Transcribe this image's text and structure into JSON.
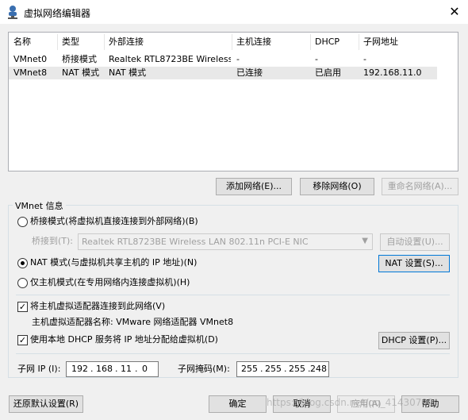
{
  "window": {
    "title": "虚拟网络编辑器",
    "close_glyph": "✕",
    "icon_name": "network-user-icon"
  },
  "table": {
    "columns": [
      "名称",
      "类型",
      "外部连接",
      "主机连接",
      "DHCP",
      "子网地址"
    ],
    "rows": [
      [
        "VMnet0",
        "桥接模式",
        "Realtek RTL8723BE Wireless...",
        "-",
        "-",
        "-"
      ],
      [
        "VMnet8",
        "NAT 模式",
        "NAT 模式",
        "已连接",
        "已启用",
        "192.168.11.0"
      ]
    ],
    "selected_row": 1
  },
  "list_buttons": {
    "add": "添加网络(E)...",
    "remove": "移除网络(O)",
    "rename": "重命名网络(A)..."
  },
  "vmnet_info": {
    "group_label": "VMnet 信息",
    "bridged_radio": "桥接模式(将虚拟机直接连接到外部网络)(B)",
    "bridged_to_label": "桥接到(T):",
    "bridged_to_value": "Realtek RTL8723BE Wireless LAN 802.11n PCI-E NIC",
    "auto_settings": "自动设置(U)...",
    "nat_radio": "NAT 模式(与虚拟机共享主机的 IP 地址)(N)",
    "nat_settings": "NAT 设置(S)...",
    "hostonly_radio": "仅主机模式(在专用网络内连接虚拟机)(H)",
    "connect_adapter_check": "将主机虚拟适配器连接到此网络(V)",
    "adapter_name_label": "主机虚拟适配器名称: VMware 网络适配器 VMnet8",
    "dhcp_check": "使用本地 DHCP 服务将 IP 地址分配给虚拟机(D)",
    "dhcp_settings": "DHCP 设置(P)...",
    "check_glyph": "✓",
    "subnet_ip_label": "子网 IP (I):",
    "subnet_ip": [
      "192",
      "168",
      "11",
      "0"
    ],
    "subnet_mask_label": "子网掩码(M):",
    "subnet_mask": [
      "255",
      "255",
      "255",
      "248"
    ],
    "ip_dot": "."
  },
  "footer": {
    "restore_defaults": "还原默认设置(R)",
    "ok": "确定",
    "cancel": "取消",
    "apply": "应用(A)",
    "help": "帮助"
  },
  "watermark": "https://blog.csdn.net/qq_41430792"
}
